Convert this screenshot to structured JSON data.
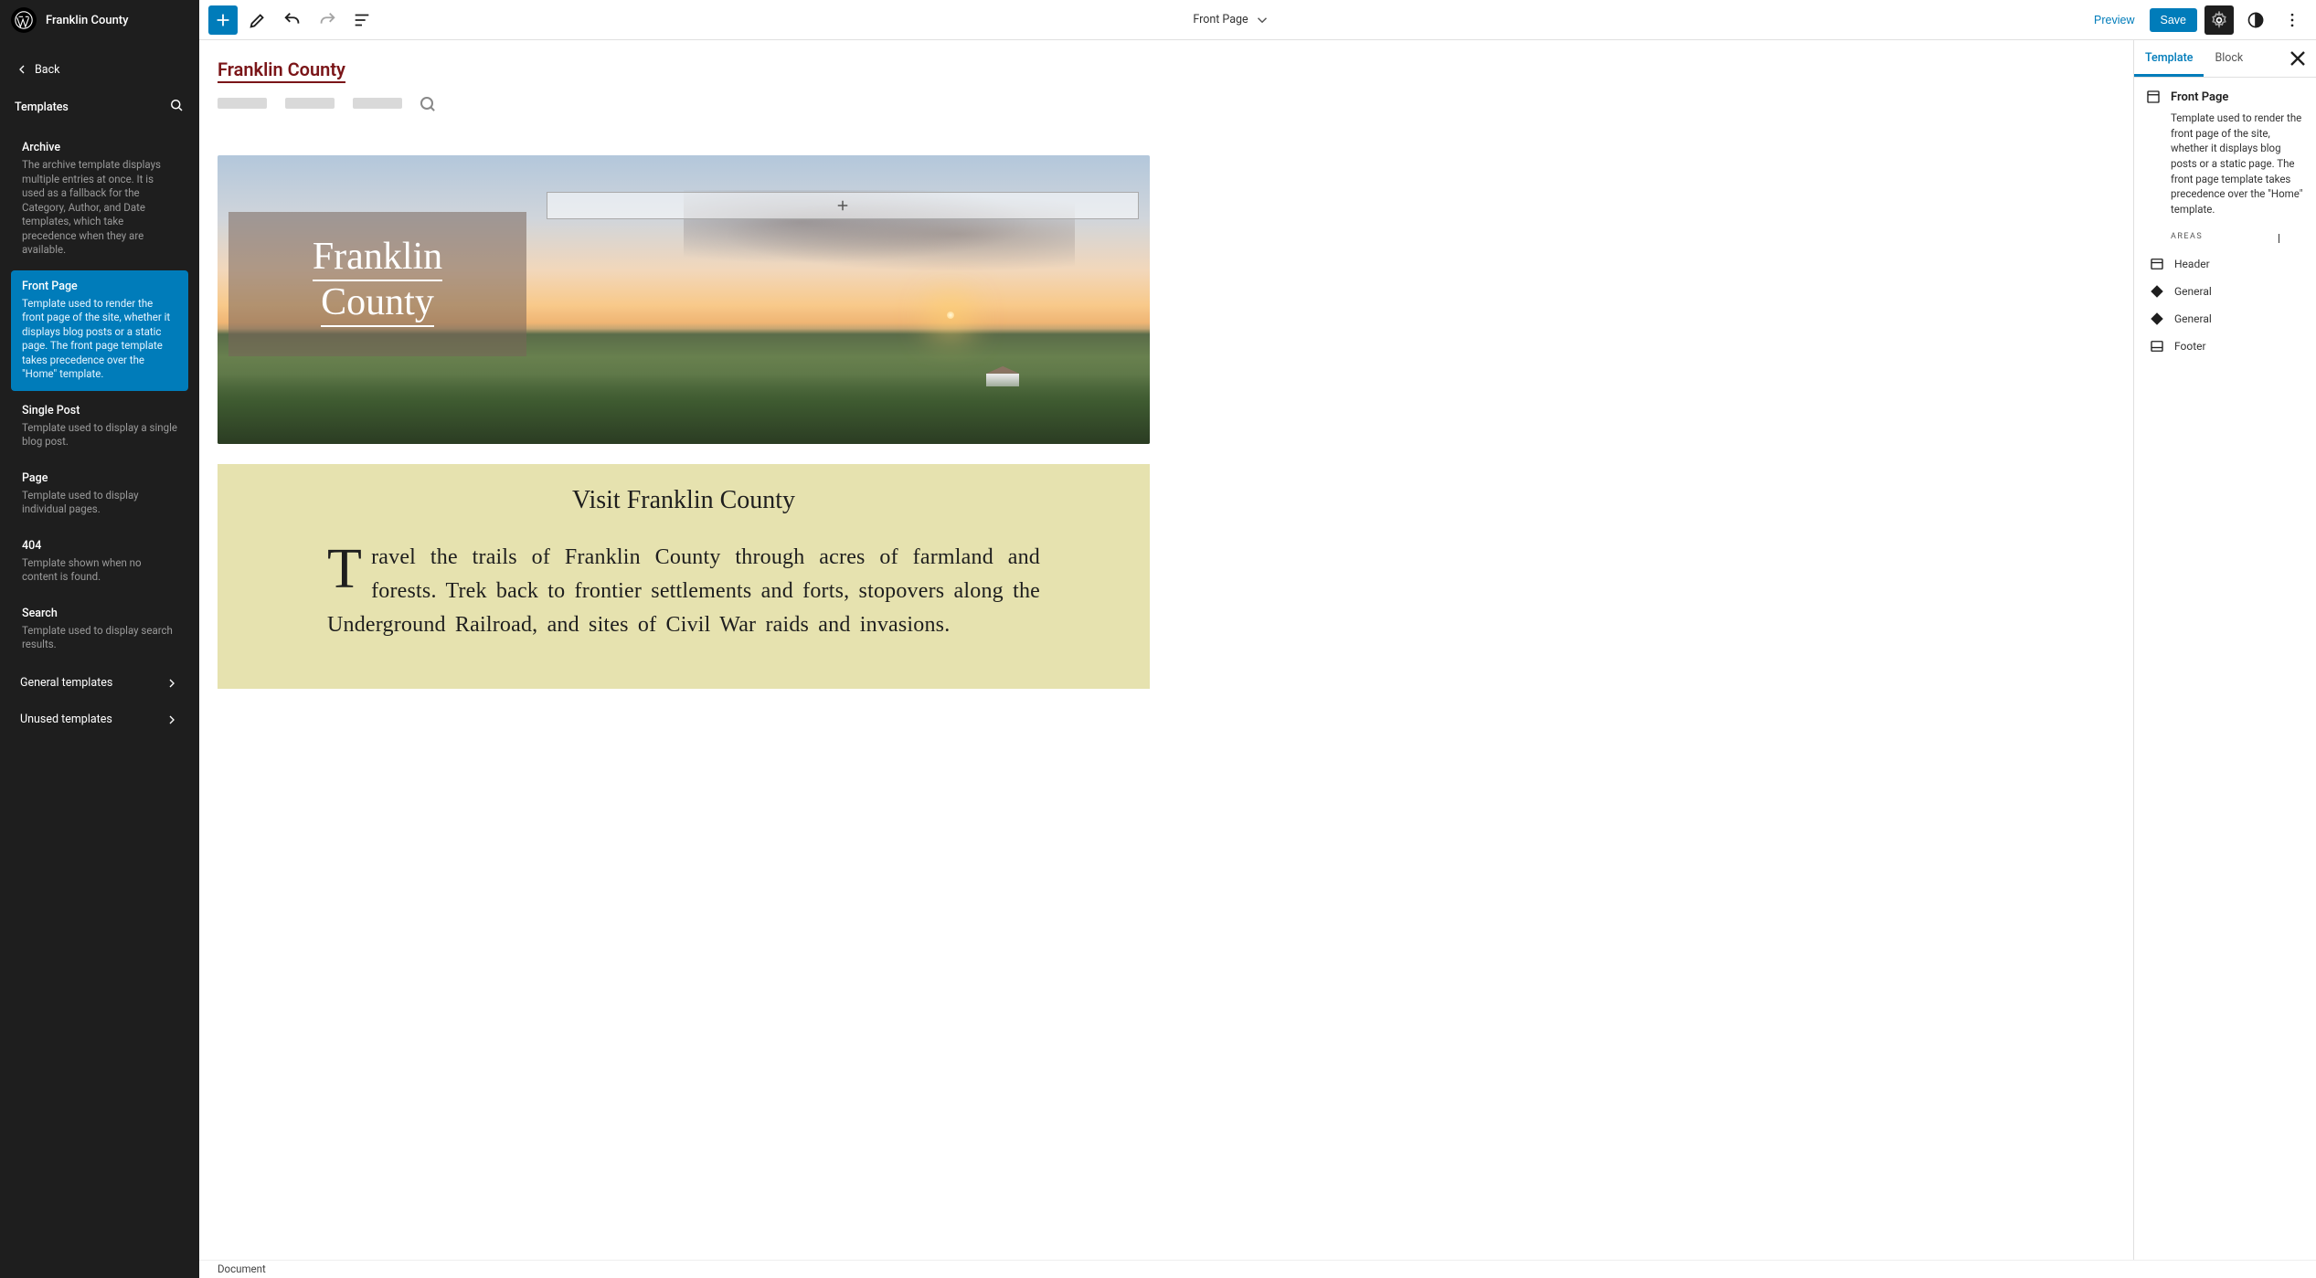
{
  "site_title": "Franklin County",
  "back_label": "Back",
  "sidebar_section": "Templates",
  "templates": [
    {
      "name": "Archive",
      "desc": "The archive template displays multiple entries at once. It is used as a fallback for the Category, Author, and Date templates, which take precedence when they are available."
    },
    {
      "name": "Front Page",
      "desc": "Template used to render the front page of the site, whether it displays blog posts or a static page. The front page template takes precedence over the \"Home\" template."
    },
    {
      "name": "Single Post",
      "desc": "Template used to display a single blog post."
    },
    {
      "name": "Page",
      "desc": "Template used to display individual pages."
    },
    {
      "name": "404",
      "desc": "Template shown when no content is found."
    },
    {
      "name": "Search",
      "desc": "Template used to display search results."
    }
  ],
  "sidebar_rows": [
    "General templates",
    "Unused templates"
  ],
  "toolbar": {
    "document_label": "Front Page",
    "preview": "Preview",
    "save": "Save"
  },
  "canvas": {
    "site_link": "Franklin County",
    "hero_title_1": "Franklin",
    "hero_title_2": "County",
    "visit_title": "Visit Franklin County",
    "visit_body": "Travel the trails of Franklin County through acres of farmland and forests. Trek back to frontier settlements and forts, stopovers along the Underground Railroad, and sites of Civil War raids and invasions."
  },
  "settings": {
    "tab_template": "Template",
    "tab_block": "Block",
    "title": "Front Page",
    "desc": "Template used to render the front page of the site, whether it displays blog posts or a static page. The front page template takes precedence over the \"Home\" template.",
    "areas_label": "AREAS",
    "areas": [
      "Header",
      "General",
      "General",
      "Footer"
    ]
  },
  "statusbar": "Document"
}
